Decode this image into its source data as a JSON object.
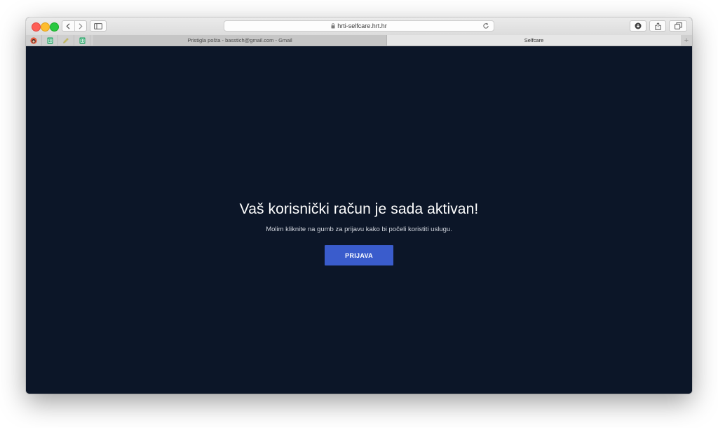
{
  "browser": {
    "url": "hrti-selfcare.hrt.hr",
    "tabs": [
      {
        "label": "Pristigla pošta - basstich@gmail.com - Gmail",
        "active": false
      },
      {
        "label": "Selfcare",
        "active": true
      }
    ],
    "new_tab_label": "+",
    "pinned_tabs": [
      "avatar-icon",
      "sheets-icon",
      "pencil-icon",
      "sheets-icon"
    ]
  },
  "page": {
    "headline": "Vaš korisnički račun je sada aktivan!",
    "subline": "Molim kliknite na gumb za prijavu kako bi počeli koristiti uslugu.",
    "login_button_label": "PRIJAVA"
  },
  "colors": {
    "background": "#0c1628",
    "button": "#3a5ccc",
    "text": "#ffffff"
  }
}
